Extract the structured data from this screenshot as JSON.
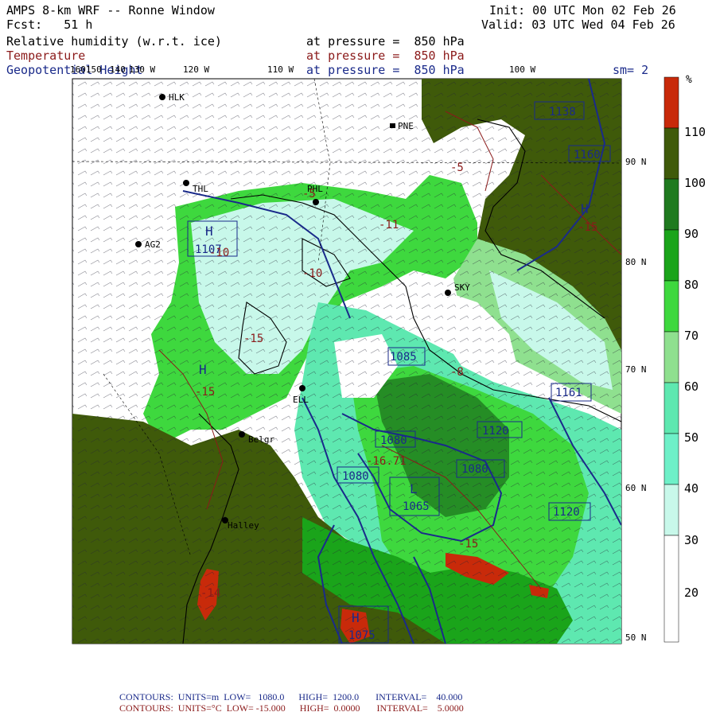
{
  "header": {
    "title": "AMPS 8-km WRF -- Ronne Window",
    "forecast": "Fcst:   51 h",
    "init": "Init: 00 UTC Mon 02 Feb 26",
    "valid": "Valid: 03 UTC Wed 04 Feb 26",
    "fields": [
      {
        "name": "Relative humidity (w.r.t. ice)",
        "level": "at pressure =  850 hPa",
        "color": "#000000"
      },
      {
        "name": "Temperature",
        "level": "at pressure =  850 hPa",
        "color": "#8b1a1a"
      },
      {
        "name": "Geopotential Height",
        "level": "at pressure =  850 hPa",
        "color": "#1a2a8a"
      }
    ],
    "smoothing": "sm= 2"
  },
  "longitude_labels": [
    "160150",
    "140",
    "130 W",
    "120 W",
    "110 W",
    "100 W"
  ],
  "latitude_labels": [
    "90 N",
    "80 N",
    "70 N",
    "60 N",
    "50 N"
  ],
  "stations": [
    "HLK",
    "PNE",
    "THL",
    "PHL",
    "AG2",
    "SKY",
    "ELL",
    "Belgr",
    "Halley"
  ],
  "height_labels": [
    "1138",
    "1160",
    "1107",
    "1080",
    "1065",
    "1080",
    "1080",
    "1120",
    "1120",
    "1161",
    "1075",
    "1085"
  ],
  "temp_labels": [
    "-5",
    "-5",
    "-10",
    "-10",
    "-11",
    "-15",
    "-15",
    "-15",
    "-15",
    "-14",
    "-16.71",
    "-8"
  ],
  "pressure_centers": [
    {
      "type": "H",
      "value": "1107"
    },
    {
      "type": "H",
      "value": "1085"
    },
    {
      "type": "L",
      "value": "1065"
    },
    {
      "type": "H",
      "value": "1075"
    },
    {
      "type": "H",
      "value": "1138"
    }
  ],
  "colorbar": {
    "unit": "%",
    "ticks": [
      "110",
      "100",
      "90",
      "80",
      "70",
      "60",
      "50",
      "40",
      "30",
      "20"
    ],
    "colors": [
      "#c82a0a",
      "#3f5a0a",
      "#1f7a1f",
      "#1aa41a",
      "#3ed83e",
      "#8fe08f",
      "#5ee8b0",
      "#6ef0c8",
      "#c8f8ea",
      "#ffffff"
    ]
  },
  "footer": {
    "line1": "CONTOURS:  UNITS=m  LOW=   1080.0      HIGH=  1200.0       INTERVAL=    40.000",
    "line2": "CONTOURS:  UNITS=°C  LOW= -15.000      HIGH=  0.0000       INTERVAL=    5.0000",
    "color1": "#1a2a8a",
    "color2": "#8b1a1a"
  }
}
